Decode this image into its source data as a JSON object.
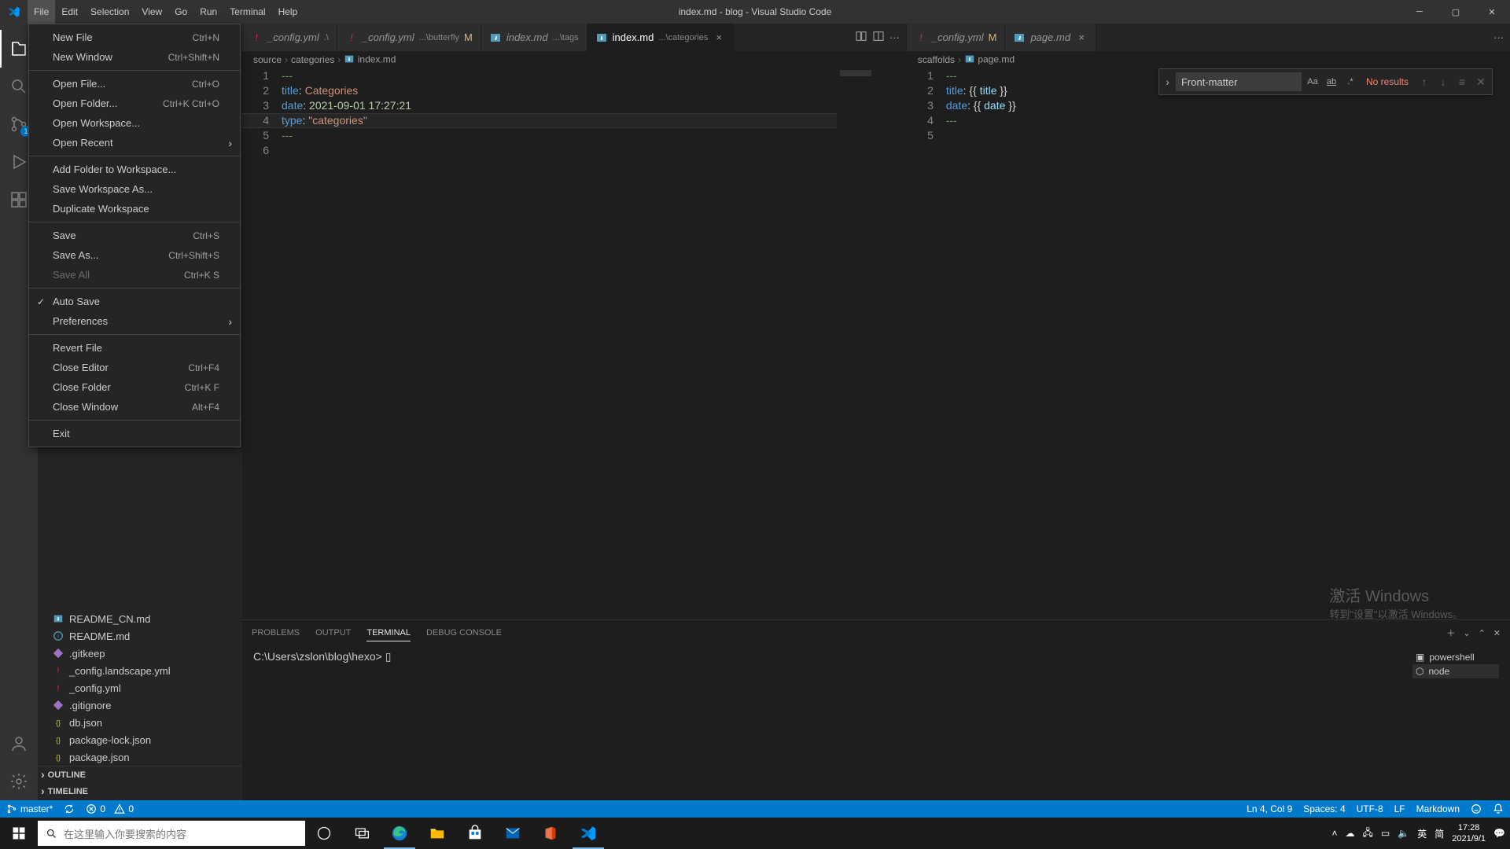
{
  "window": {
    "title": "index.md - blog - Visual Studio Code"
  },
  "menubar": [
    "File",
    "Edit",
    "Selection",
    "View",
    "Go",
    "Run",
    "Terminal",
    "Help"
  ],
  "file_menu": [
    [
      {
        "label": "New File",
        "kb": "Ctrl+N"
      },
      {
        "label": "New Window",
        "kb": "Ctrl+Shift+N"
      }
    ],
    [
      {
        "label": "Open File...",
        "kb": "Ctrl+O"
      },
      {
        "label": "Open Folder...",
        "kb": "Ctrl+K Ctrl+O"
      },
      {
        "label": "Open Workspace..."
      },
      {
        "label": "Open Recent",
        "sub": true
      }
    ],
    [
      {
        "label": "Add Folder to Workspace..."
      },
      {
        "label": "Save Workspace As..."
      },
      {
        "label": "Duplicate Workspace"
      }
    ],
    [
      {
        "label": "Save",
        "kb": "Ctrl+S"
      },
      {
        "label": "Save As...",
        "kb": "Ctrl+Shift+S"
      },
      {
        "label": "Save All",
        "kb": "Ctrl+K S",
        "disabled": true
      }
    ],
    [
      {
        "label": "Auto Save",
        "checked": true
      },
      {
        "label": "Preferences",
        "sub": true
      }
    ],
    [
      {
        "label": "Revert File"
      },
      {
        "label": "Close Editor",
        "kb": "Ctrl+F4"
      },
      {
        "label": "Close Folder",
        "kb": "Ctrl+K F"
      },
      {
        "label": "Close Window",
        "kb": "Alt+F4"
      }
    ],
    [
      {
        "label": "Exit"
      }
    ]
  ],
  "activity_badge": "1",
  "tree_tail": [
    {
      "icon": "md",
      "label": "README_CN.md",
      "color": "#519aba"
    },
    {
      "icon": "info",
      "label": "README.md",
      "color": "#519aba"
    },
    {
      "icon": "git",
      "label": ".gitkeep",
      "color": "#a074c4"
    },
    {
      "icon": "yml",
      "label": "_config.landscape.yml",
      "color": "#e8274b"
    },
    {
      "icon": "yml",
      "label": "_config.yml",
      "color": "#e8274b"
    },
    {
      "icon": "git",
      "label": ".gitignore",
      "color": "#a074c4"
    },
    {
      "icon": "json",
      "label": "db.json",
      "color": "#cbcb41"
    },
    {
      "icon": "json",
      "label": "package-lock.json",
      "color": "#cbcb41"
    },
    {
      "icon": "json",
      "label": "package.json",
      "color": "#cbcb41"
    }
  ],
  "panels": {
    "outline": "OUTLINE",
    "timeline": "TIMELINE"
  },
  "tabs_left": [
    {
      "icon": "yml",
      "name": "_config.yml",
      "desc": ".\\",
      "mod": false,
      "color": "#e8274b"
    },
    {
      "icon": "yml",
      "name": "_config.yml",
      "desc": "...\\butterfly",
      "mod": true,
      "color": "#e8274b"
    },
    {
      "icon": "md",
      "name": "index.md",
      "desc": "...\\tags",
      "mod": false,
      "color": "#519aba"
    },
    {
      "icon": "md",
      "name": "index.md",
      "desc": "...\\categories",
      "mod": false,
      "active": true,
      "color": "#519aba"
    }
  ],
  "tabs_right": [
    {
      "icon": "yml",
      "name": "_config.yml",
      "mod": true,
      "color": "#e8274b"
    },
    {
      "icon": "md",
      "name": "page.md",
      "mod": false,
      "color": "#519aba",
      "close": true
    }
  ],
  "breadcrumb_left": [
    "source",
    "categories",
    "index.md"
  ],
  "breadcrumb_right": [
    "scaffolds",
    "page.md"
  ],
  "code_left": {
    "lines": [
      {
        "n": 1,
        "t": [
          {
            "c": "tok-dash",
            "v": "---"
          }
        ]
      },
      {
        "n": 2,
        "t": [
          {
            "c": "tok-key",
            "v": "title"
          },
          {
            "c": "tok-punc",
            "v": ": "
          },
          {
            "c": "tok-str",
            "v": "Categories"
          }
        ]
      },
      {
        "n": 3,
        "t": [
          {
            "c": "tok-key",
            "v": "date"
          },
          {
            "c": "tok-punc",
            "v": ": "
          },
          {
            "c": "tok-num",
            "v": "2021-09-01 17:27:21"
          }
        ]
      },
      {
        "n": 4,
        "t": [
          {
            "c": "tok-key",
            "v": "type"
          },
          {
            "c": "tok-punc",
            "v": ": "
          },
          {
            "c": "tok-str",
            "v": "\"categories\""
          }
        ]
      },
      {
        "n": 5,
        "t": [
          {
            "c": "tok-dash",
            "v": "---"
          }
        ]
      },
      {
        "n": 6,
        "t": []
      }
    ],
    "cursor_line_index": 3
  },
  "code_right": {
    "lines": [
      {
        "n": 1,
        "t": [
          {
            "c": "tok-dash",
            "v": "---"
          }
        ]
      },
      {
        "n": 2,
        "t": [
          {
            "c": "tok-key",
            "v": "title"
          },
          {
            "c": "tok-punc",
            "v": ": {{ "
          },
          {
            "c": "tok-var",
            "v": "title"
          },
          {
            "c": "tok-punc",
            "v": " }}"
          }
        ]
      },
      {
        "n": 3,
        "t": [
          {
            "c": "tok-key",
            "v": "date"
          },
          {
            "c": "tok-punc",
            "v": ": {{ "
          },
          {
            "c": "tok-var",
            "v": "date"
          },
          {
            "c": "tok-punc",
            "v": " }}"
          }
        ]
      },
      {
        "n": 4,
        "t": [
          {
            "c": "tok-dash",
            "v": "---"
          }
        ]
      },
      {
        "n": 5,
        "t": []
      }
    ]
  },
  "find": {
    "value": "Front-matter",
    "result": "No results"
  },
  "panel_tabs": [
    "PROBLEMS",
    "OUTPUT",
    "TERMINAL",
    "DEBUG CONSOLE"
  ],
  "panel_active": "TERMINAL",
  "terminal": {
    "prompt": "C:\\Users\\zslon\\blog\\hexo>",
    "cursor": "▯"
  },
  "terminal_side": [
    {
      "label": "powershell",
      "icon": "ps"
    },
    {
      "label": "node",
      "icon": "node",
      "sel": true
    }
  ],
  "status_left": {
    "branch": "master*",
    "sync": "",
    "errors": "0",
    "warnings": "0"
  },
  "status_right": {
    "pos": "Ln 4, Col 9",
    "spaces": "Spaces: 4",
    "enc": "UTF-8",
    "eol": "LF",
    "lang": "Markdown"
  },
  "watermark": {
    "l1": "激活 Windows",
    "l2": "转到\"设置\"以激活 Windows。"
  },
  "taskbar": {
    "search_placeholder": "在这里输入你要搜索的内容",
    "time": "17:28",
    "date": "2021/9/1",
    "ime1": "英",
    "ime2": "简"
  }
}
